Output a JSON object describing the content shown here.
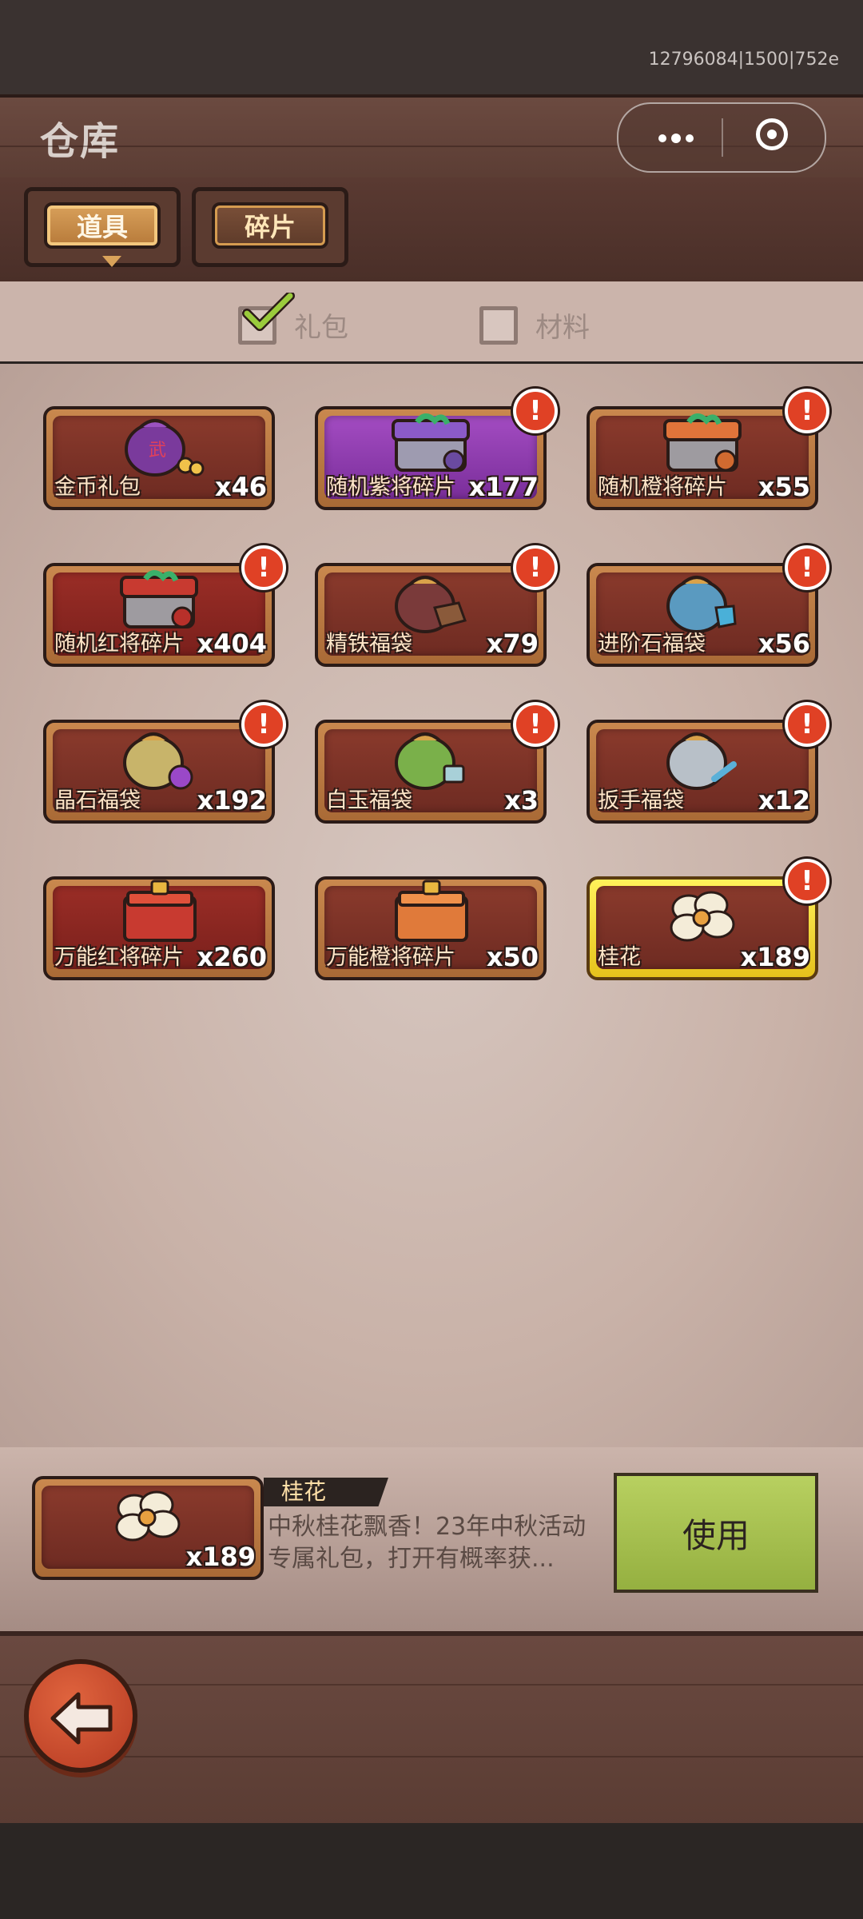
{
  "status_bar": {
    "build_id": "12796084|1500|752e"
  },
  "header": {
    "title": "仓库"
  },
  "capsule": {
    "more_icon": "ellipsis-icon",
    "close_icon": "target-close-icon"
  },
  "tabs": [
    {
      "label": "道具",
      "active": true
    },
    {
      "label": "碎片",
      "active": false
    }
  ],
  "filters": [
    {
      "label": "礼包",
      "checked": true
    },
    {
      "label": "材料",
      "checked": false
    }
  ],
  "items": [
    {
      "label": "金币礼包",
      "count": "x46",
      "alert": false,
      "style": "orange",
      "icon": "coin-bag-icon"
    },
    {
      "label": "随机紫将碎片",
      "count": "x177",
      "alert": true,
      "style": "purple",
      "icon": "purple-chest-icon"
    },
    {
      "label": "随机橙将碎片",
      "count": "x55",
      "alert": true,
      "style": "orange",
      "icon": "orange-chest-icon"
    },
    {
      "label": "随机红将碎片",
      "count": "x404",
      "alert": true,
      "style": "red",
      "icon": "red-chest-icon"
    },
    {
      "label": "精铁福袋",
      "count": "x79",
      "alert": true,
      "style": "orange",
      "icon": "iron-bag-icon"
    },
    {
      "label": "进阶石福袋",
      "count": "x56",
      "alert": true,
      "style": "orange",
      "icon": "stone-bag-icon"
    },
    {
      "label": "晶石福袋",
      "count": "x192",
      "alert": true,
      "style": "orange",
      "icon": "crystal-bag-icon"
    },
    {
      "label": "白玉福袋",
      "count": "x3",
      "alert": true,
      "style": "orange",
      "icon": "jade-bag-icon"
    },
    {
      "label": "扳手福袋",
      "count": "x12",
      "alert": true,
      "style": "orange",
      "icon": "wrench-bag-icon"
    },
    {
      "label": "万能红将碎片",
      "count": "x260",
      "alert": false,
      "style": "red",
      "icon": "red-box-icon"
    },
    {
      "label": "万能橙将碎片",
      "count": "x50",
      "alert": false,
      "style": "orange",
      "icon": "orange-box-icon"
    },
    {
      "label": "桂花",
      "count": "x189",
      "alert": true,
      "style": "gold",
      "icon": "osmanthus-icon"
    }
  ],
  "selected": {
    "name": "桂花",
    "count": "x189",
    "description": "中秋桂花飘香！23年中秋活动专属礼包，打开有概率获...",
    "use_label": "使用"
  },
  "footer": {
    "back_icon": "back-arrow-icon"
  },
  "colors": {
    "accent_gold": "#f3c77d",
    "alert_red": "#e04125",
    "use_green": "#a9c250"
  }
}
